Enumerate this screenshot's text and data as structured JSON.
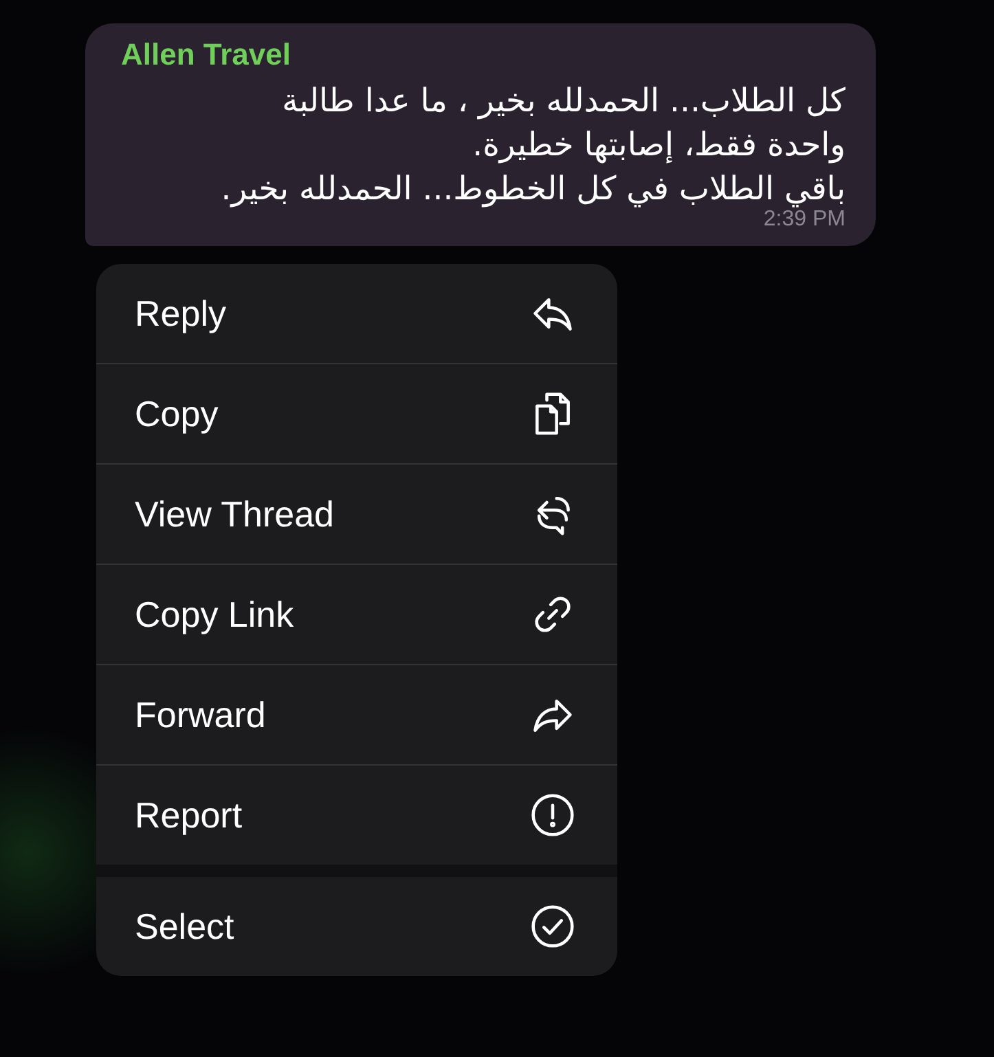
{
  "message": {
    "sender": "Allen Travel",
    "text": "كل  الطلاب... الحمدلله بخير ، ما عدا طالبة\nواحدة فقط، إصابتها خطيرة.\nباقي الطلاب في كل الخطوط... الحمدلله بخير.",
    "time": "2:39 PM"
  },
  "menu": {
    "sections": [
      [
        {
          "label": "Reply",
          "kind": "reply"
        },
        {
          "label": "Copy",
          "kind": "copy"
        },
        {
          "label": "View Thread",
          "kind": "thread"
        },
        {
          "label": "Copy Link",
          "kind": "link"
        },
        {
          "label": "Forward",
          "kind": "forward"
        },
        {
          "label": "Report",
          "kind": "report"
        }
      ],
      [
        {
          "label": "Select",
          "kind": "select"
        }
      ]
    ]
  }
}
